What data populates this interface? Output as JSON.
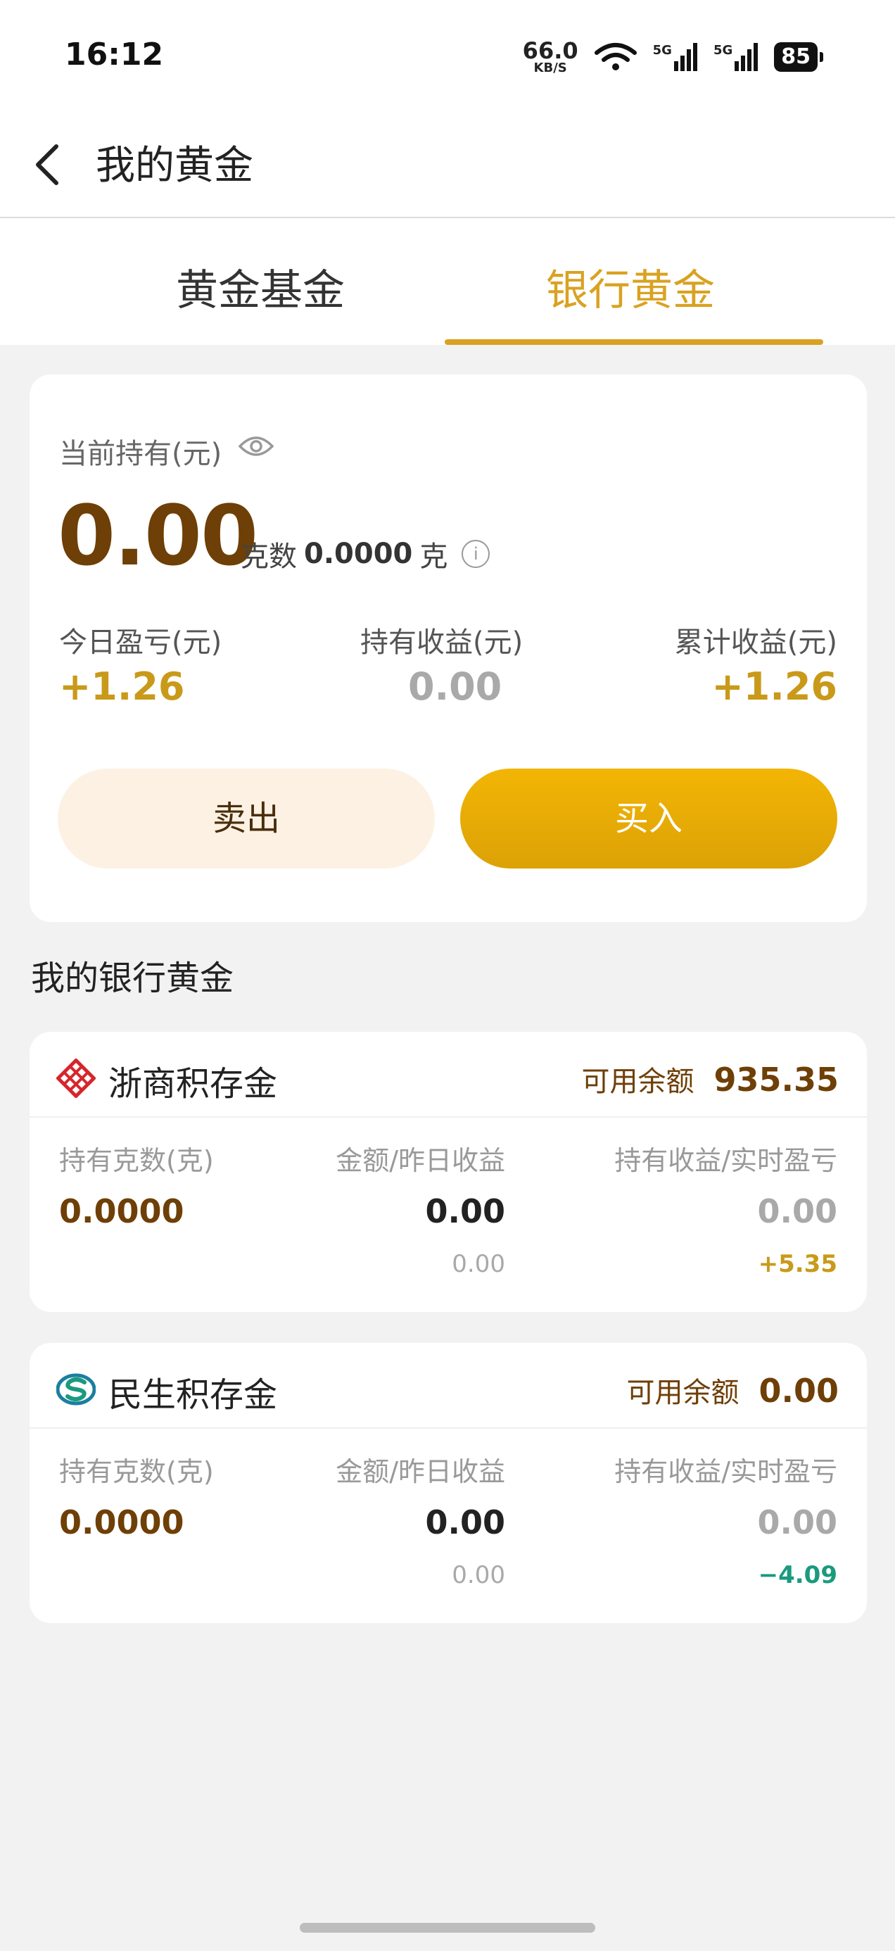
{
  "status": {
    "time": "16:12",
    "net_speed_value": "66.0",
    "net_speed_unit": "KB/S",
    "signal1_label": "5G",
    "signal2_label": "5G",
    "battery": "85"
  },
  "header": {
    "title": "我的黄金"
  },
  "tabs": [
    {
      "label": "黄金基金",
      "active": false
    },
    {
      "label": "银行黄金",
      "active": true
    }
  ],
  "holding": {
    "label": "当前持有(元)",
    "amount": "0.00",
    "grams_label": "克数",
    "grams_value": "0.0000",
    "grams_unit": "克",
    "stats": [
      {
        "label": "今日盈亏(元)",
        "value": "+1.26"
      },
      {
        "label": "持有收益(元)",
        "value": "0.00"
      },
      {
        "label": "累计收益(元)",
        "value": "+1.26"
      }
    ],
    "sell_label": "卖出",
    "buy_label": "买入"
  },
  "section_title": "我的银行黄金",
  "banks": [
    {
      "name": "浙商积存金",
      "avail_label": "可用余额",
      "avail_value": "935.35",
      "col1_label": "持有克数(克)",
      "col2_label": "金额/昨日收益",
      "col3_label": "持有收益/实时盈亏",
      "grams": "0.0000",
      "amount": "0.00",
      "yesterday": "0.00",
      "hold_profit": "0.00",
      "realtime": "+5.35"
    },
    {
      "name": "民生积存金",
      "avail_label": "可用余额",
      "avail_value": "0.00",
      "col1_label": "持有克数(克)",
      "col2_label": "金额/昨日收益",
      "col3_label": "持有收益/实时盈亏",
      "grams": "0.0000",
      "amount": "0.00",
      "yesterday": "0.00",
      "hold_profit": "0.00",
      "realtime": "−4.09"
    }
  ],
  "colors": {
    "accent_gold": "#d9a221",
    "brown": "#6e3f06",
    "loss_green": "#1a9a7e"
  }
}
